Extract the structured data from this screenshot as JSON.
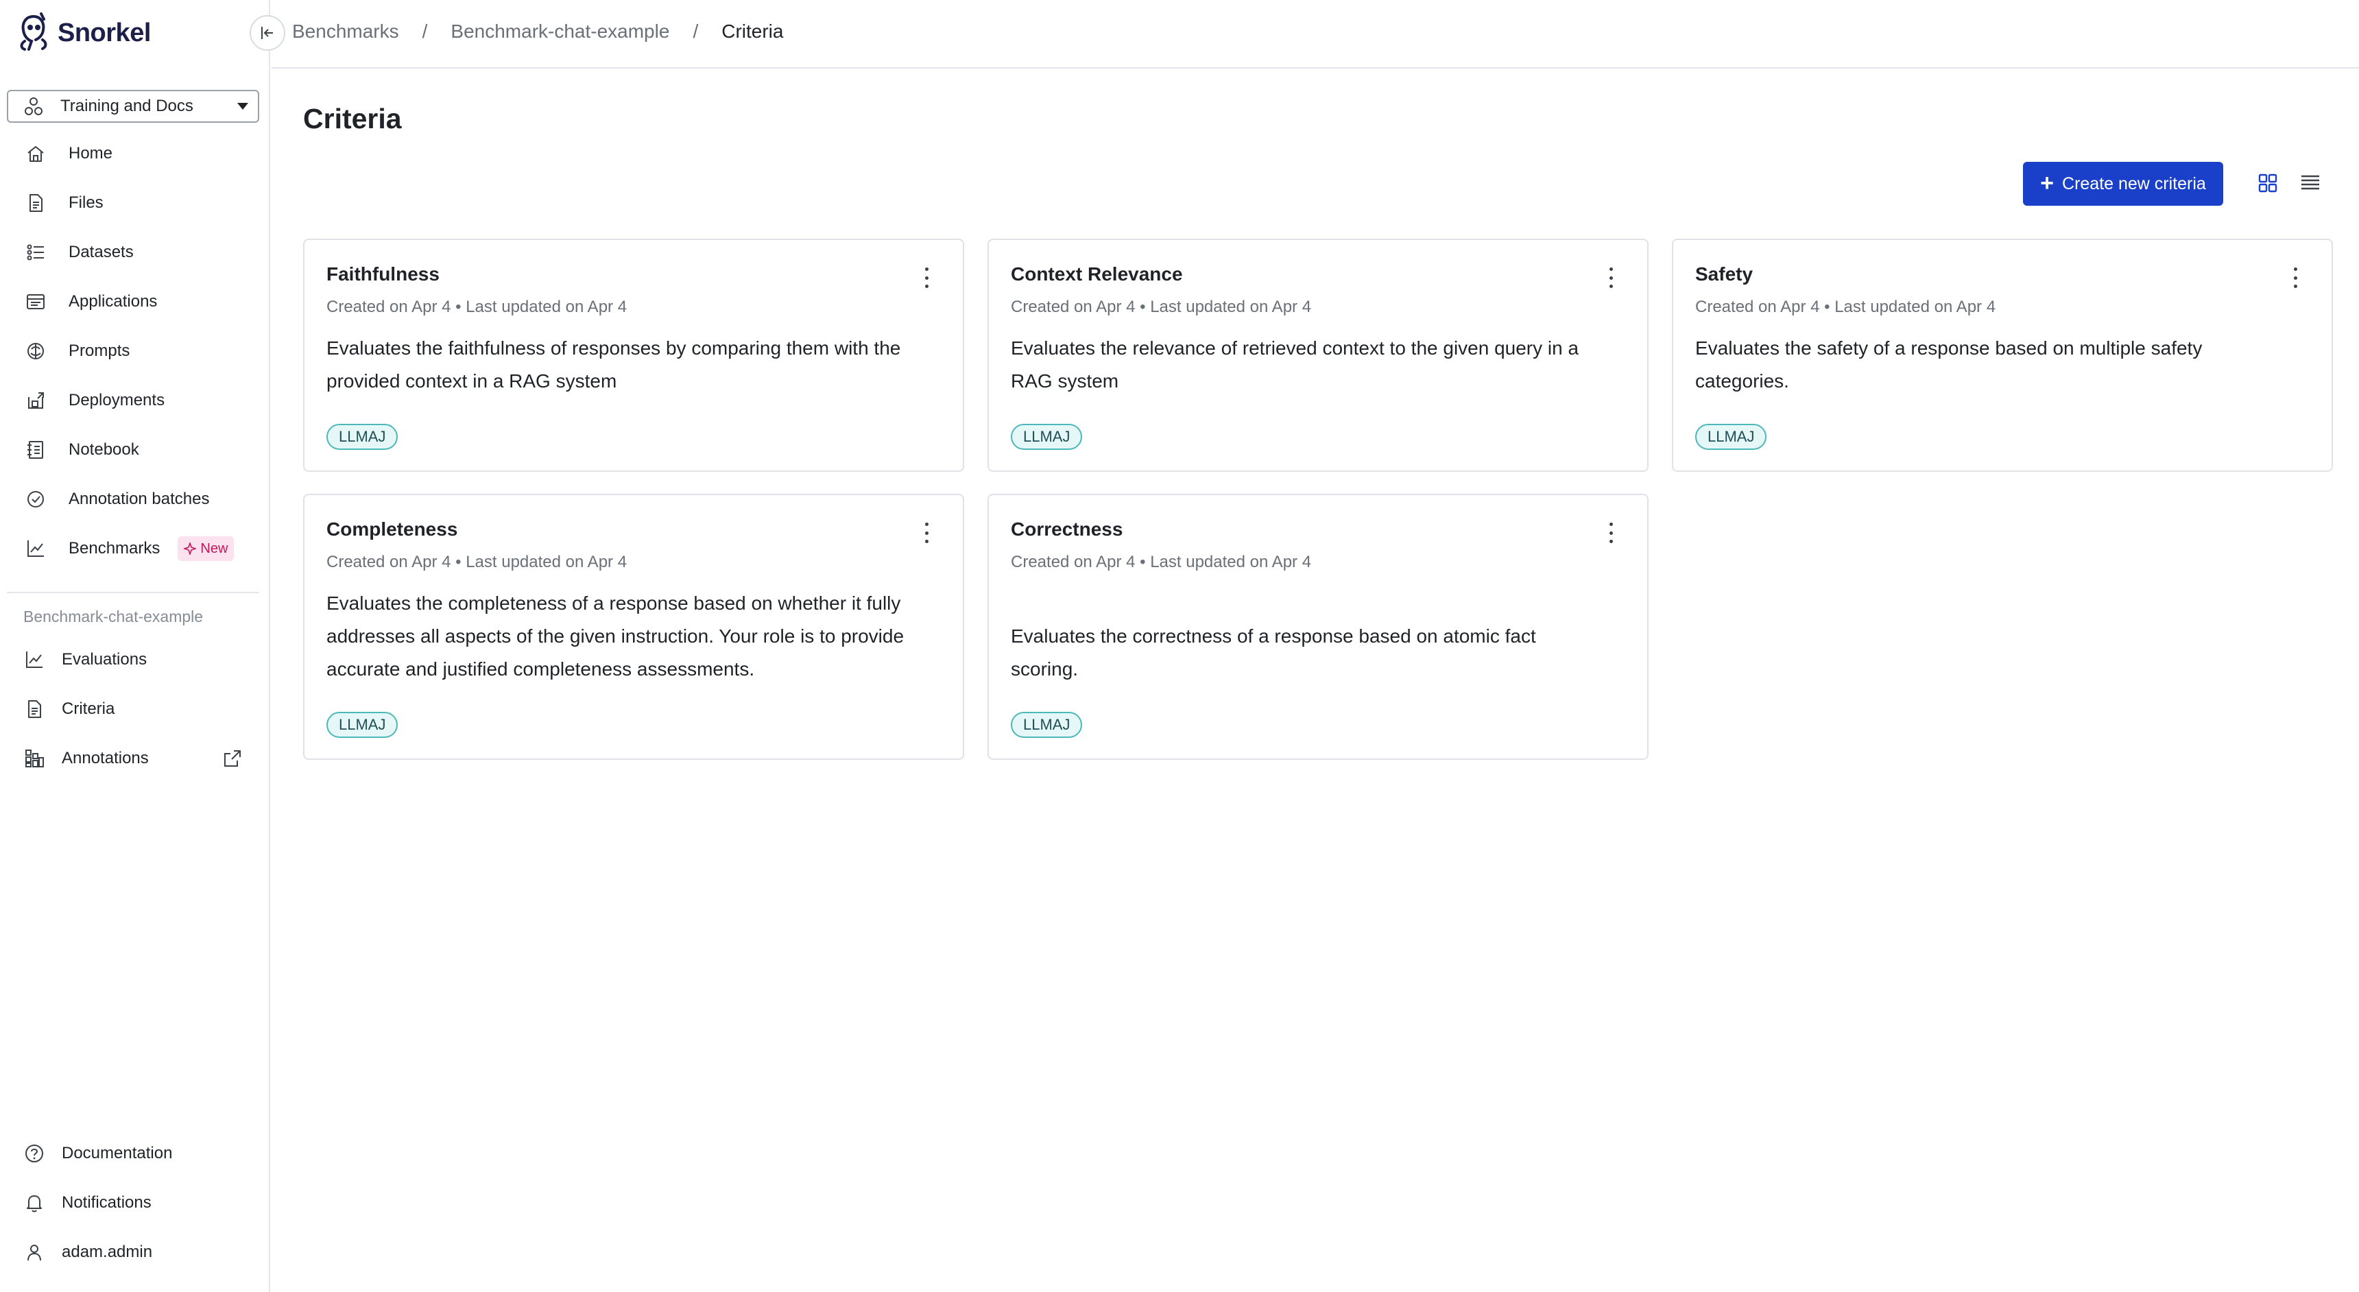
{
  "app": {
    "name": "Snorkel"
  },
  "sidebar": {
    "workspace": "Training and Docs",
    "nav": [
      {
        "label": "Home",
        "icon": "home-icon"
      },
      {
        "label": "Files",
        "icon": "file-icon"
      },
      {
        "label": "Datasets",
        "icon": "datasets-icon"
      },
      {
        "label": "Applications",
        "icon": "applications-icon"
      },
      {
        "label": "Prompts",
        "icon": "prompts-icon"
      },
      {
        "label": "Deployments",
        "icon": "deployments-icon"
      },
      {
        "label": "Notebook",
        "icon": "notebook-icon"
      },
      {
        "label": "Annotation batches",
        "icon": "annotation-batches-icon"
      },
      {
        "label": "Benchmarks",
        "icon": "benchmarks-icon",
        "badge": "New"
      }
    ],
    "section_label": "Benchmark-chat-example",
    "sub_nav": [
      {
        "label": "Evaluations",
        "icon": "evaluations-icon"
      },
      {
        "label": "Criteria",
        "icon": "criteria-icon"
      },
      {
        "label": "Annotations",
        "icon": "annotations-icon"
      }
    ],
    "bottom": [
      {
        "label": "Documentation",
        "icon": "help-icon"
      },
      {
        "label": "Notifications",
        "icon": "bell-icon"
      },
      {
        "label": "adam.admin",
        "icon": "user-icon"
      }
    ]
  },
  "breadcrumb": {
    "items": [
      "Benchmarks",
      "Benchmark-chat-example"
    ],
    "separator": "/",
    "current": "Criteria"
  },
  "page": {
    "title": "Criteria",
    "create_button": "Create new criteria"
  },
  "criteria": [
    {
      "title": "Faithfulness",
      "meta": "Created on Apr 4 • Last updated on Apr 4",
      "description": "Evaluates the faithfulness of responses by comparing them with the provided context in a RAG system",
      "tag": "LLMAJ"
    },
    {
      "title": "Context Relevance",
      "meta": "Created on Apr 4 • Last updated on Apr 4",
      "description": "Evaluates the relevance of retrieved context to the given query in a RAG system",
      "tag": "LLMAJ"
    },
    {
      "title": "Safety",
      "meta": "Created on Apr 4 • Last updated on Apr 4",
      "description": "Evaluates the safety of a response based on multiple safety categories.",
      "tag": "LLMAJ"
    },
    {
      "title": "Completeness",
      "meta": "Created on Apr 4 • Last updated on Apr 4",
      "description": "Evaluates the completeness of a response based on whether it fully addresses all aspects of the given instruction. Your role is to provide accurate and justified completeness assessments.",
      "tag": "LLMAJ"
    },
    {
      "title": "Correctness",
      "meta": "Created on Apr 4 • Last updated on Apr 4",
      "description": "Evaluates the correctness of a response based on atomic fact scoring.",
      "tag": "LLMAJ"
    }
  ],
  "colors": {
    "accent": "#1a3fc8",
    "tag_border": "#4bb9b9",
    "tag_bg": "#e6f7f7",
    "new_badge_bg": "#fbe2ee",
    "new_badge_text": "#c2185b"
  }
}
